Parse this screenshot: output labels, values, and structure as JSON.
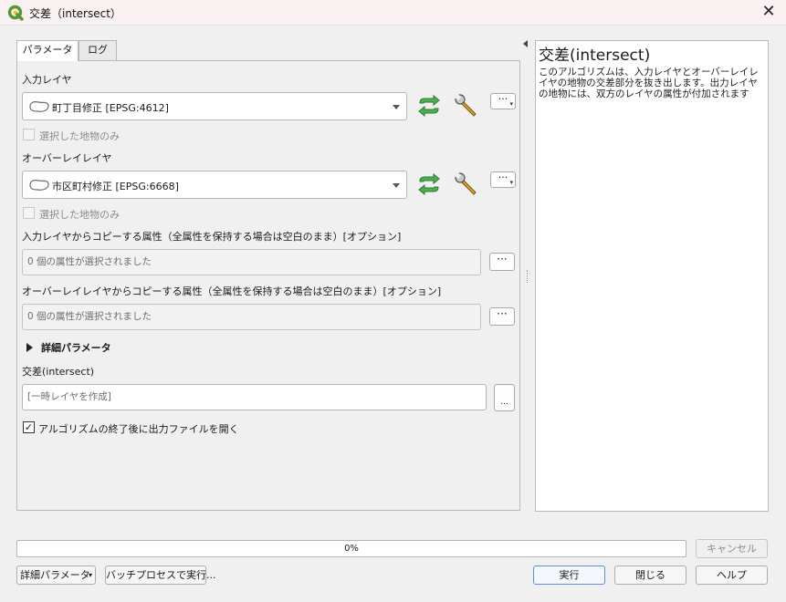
{
  "window": {
    "title": "交差（intersect）",
    "close_glyph": "✕"
  },
  "tabs": [
    {
      "label": "パラメータ",
      "active": true
    },
    {
      "label": "ログ",
      "active": false
    }
  ],
  "params": {
    "input_layer_label": "入力レイヤ",
    "input_layer_value": "町丁目修正 [EPSG:4612]",
    "input_selected_only_label": "選択した地物のみ",
    "overlay_layer_label": "オーバーレイレイヤ",
    "overlay_layer_value": "市区町村修正 [EPSG:6668]",
    "overlay_selected_only_label": "選択した地物のみ",
    "input_fields_label": "入力レイヤからコピーする属性（全属性を保持する場合は空白のまま）[オプション]",
    "input_fields_value": "0 個の属性が選択されました",
    "overlay_fields_label": "オーバーレイレイヤからコピーする属性（全属性を保持する場合は空白のまま）[オプション]",
    "overlay_fields_value": "0 個の属性が選択されました",
    "advanced_label": "詳細パラメータ",
    "output_label": "交差(intersect)",
    "output_placeholder": "[一時レイヤを作成]",
    "open_output_label": "アルゴリズムの終了後に出力ファイルを開く",
    "open_output_checked": true,
    "dots": "···",
    "dots_small": "..."
  },
  "help": {
    "title": "交差(intersect)",
    "body": "このアルゴリズムは、入力レイヤとオーバーレイレイヤの地物の交差部分を抜き出します。出力レイヤの地物には、双方のレイヤの属性が付加されます"
  },
  "bottom": {
    "progress_text": "0%",
    "progress_value": 0,
    "cancel_label": "キャンセル",
    "advanced_button_label": "詳細パラメータ",
    "batch_button_label": "バッチプロセスで実行...",
    "run_label": "実行",
    "close_label": "閉じる",
    "help_label": "ヘルプ"
  },
  "colors": {
    "qgis_green": "#589632",
    "run_border": "#5b8fd6",
    "sync_green": "#4caf50"
  }
}
